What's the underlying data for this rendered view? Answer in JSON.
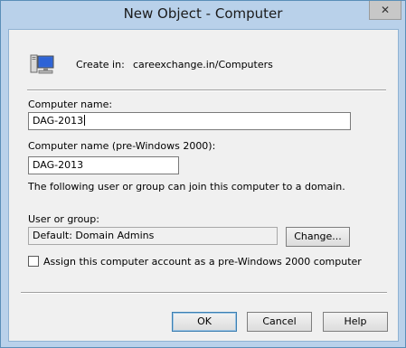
{
  "window": {
    "title": "New Object - Computer",
    "close_glyph": "✕"
  },
  "header": {
    "create_in_label": "Create in:",
    "create_in_value": "careexchange.in/Computers"
  },
  "form": {
    "computer_name_label": "Computer name:",
    "computer_name_value": "DAG-2013",
    "pre2000_label": "Computer name (pre-Windows 2000):",
    "pre2000_value": "DAG-2013",
    "join_note": "The following user or group can join this computer to a domain.",
    "user_group_label": "User or group:",
    "user_group_value": "Default: Domain Admins",
    "change_button": "Change...",
    "assign_checkbox_label": "Assign this computer account as a pre-Windows 2000 computer",
    "assign_checked": false
  },
  "buttons": {
    "ok": "OK",
    "cancel": "Cancel",
    "help": "Help"
  },
  "colors": {
    "title_bar": "#b9d1ea",
    "dialog_bg": "#f0f0f0",
    "default_button_border": "#3c7fb1"
  }
}
